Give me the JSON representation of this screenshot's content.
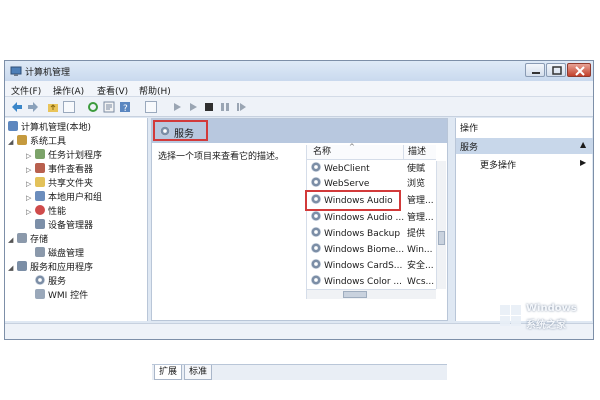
{
  "window": {
    "title": "计算机管理"
  },
  "menu": [
    "文件(F)",
    "操作(A)",
    "查看(V)",
    "帮助(H)"
  ],
  "tree": {
    "root": "计算机管理(本地)",
    "items": [
      "系统工具",
      "任务计划程序",
      "事件查看器",
      "共享文件夹",
      "本地用户和组",
      "性能",
      "设备管理器",
      "存储",
      "磁盘管理",
      "服务和应用程序",
      "服务",
      "WMI 控件"
    ]
  },
  "center": {
    "header": "服务",
    "description": "选择一个项目来查看它的描述。",
    "columns": {
      "name": "名称",
      "desc": "描述"
    },
    "services": [
      {
        "name": "WebClient",
        "desc": "使赋"
      },
      {
        "name": "WebServe",
        "desc": "浏览"
      },
      {
        "name": "Windows Audio",
        "desc": "管理..."
      },
      {
        "name": "Windows Audio ...",
        "desc": "管理..."
      },
      {
        "name": "Windows Backup",
        "desc": "提供"
      },
      {
        "name": "Windows Biome...",
        "desc": "Win..."
      },
      {
        "name": "Windows CardS...",
        "desc": "安全..."
      },
      {
        "name": "Windows Color ...",
        "desc": "Wcs..."
      }
    ],
    "tabs": [
      "扩展",
      "标准"
    ]
  },
  "actions": {
    "header": "操作",
    "section": "服务",
    "more": "更多操作"
  },
  "watermark": {
    "line1": "Windows",
    "line2": "系统之家"
  },
  "colors": {
    "highlight": "#d23a3a",
    "header_blue": "#b8c8df"
  }
}
